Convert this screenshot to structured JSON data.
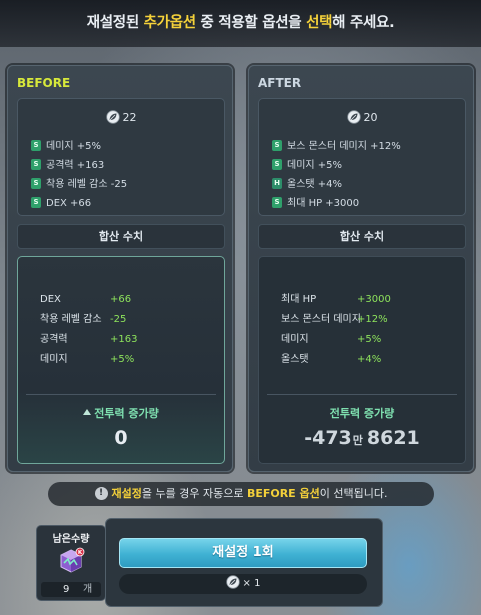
{
  "header": {
    "pre": "재설정된 ",
    "highlight1": "추가옵션",
    "mid": " 중 적용할 옵션을 ",
    "highlight2": "선택",
    "post": "해 주세요."
  },
  "before": {
    "title": "BEFORE",
    "leaf_count": "22",
    "options": [
      {
        "grade": "S",
        "text": "데미지 +5%"
      },
      {
        "grade": "S",
        "text": "공격력 +163"
      },
      {
        "grade": "S",
        "text": "착용 레벨 감소 -25"
      },
      {
        "grade": "S",
        "text": "DEX +66"
      }
    ],
    "sum_label": "합산 수치",
    "sum_rows": [
      {
        "key": "DEX",
        "value": "+66"
      },
      {
        "key": "착용 레벨 감소",
        "value": "-25"
      },
      {
        "key": "공격력",
        "value": "+163"
      },
      {
        "key": "데미지",
        "value": "+5%"
      }
    ],
    "gain_label": "전투력 증가량",
    "gain_value": "0"
  },
  "after": {
    "title": "AFTER",
    "leaf_count": "20",
    "options": [
      {
        "grade": "S",
        "text": "보스 몬스터 데미지 +12%"
      },
      {
        "grade": "S",
        "text": "데미지 +5%"
      },
      {
        "grade": "H",
        "text": "올스탯 +4%"
      },
      {
        "grade": "S",
        "text": "최대 HP +3000"
      }
    ],
    "sum_label": "합산 수치",
    "sum_rows": [
      {
        "key": "최대 HP",
        "value": "+3000"
      },
      {
        "key": "보스 몬스터 데미지",
        "value": "+12%"
      },
      {
        "key": "데미지",
        "value": "+5%"
      },
      {
        "key": "올스탯",
        "value": "+4%"
      }
    ],
    "gain_label": "전투력 증가량",
    "gain_value_a": "-473",
    "gain_value_unit": "만",
    "gain_value_b": "8621"
  },
  "notice": {
    "hl1": "재설정",
    "mid": "을 누를 경우 자동으로 ",
    "hl2": "BEFORE 옵션",
    "post": "이 선택됩니다.",
    "icon": "!"
  },
  "remaining": {
    "label": "남은수량",
    "count": "9",
    "unit": "개"
  },
  "action": {
    "reset_label": "재설정 1회",
    "cost": "× 1"
  },
  "colors": {
    "accent_yellow": "#f5d23a",
    "stat_green": "#8ee35c",
    "gain_label": "#7fe0b0",
    "button_blue": "#3fb1d3"
  },
  "icons": {
    "leaf": "leaf-icon",
    "cube": "cube-icon",
    "info": "info-icon",
    "arrow": "arrow-up-icon"
  }
}
